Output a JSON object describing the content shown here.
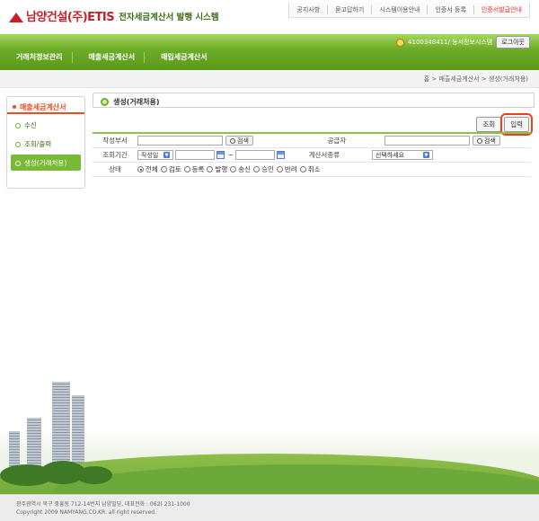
{
  "header": {
    "logo_name": "남양건설(주)ETIS",
    "logo_subtitle": "전자세금계산서 발행 시스템",
    "top_links": [
      "공지사항",
      "묻고답하기",
      "시스템이용안내",
      "인증서 등록",
      "인증서발급안내"
    ]
  },
  "user": {
    "info": "4100348411/ 동서정보시스템",
    "logout_label": "로그아웃"
  },
  "nav": {
    "items": [
      "거래처정보관리",
      "매출세금계산서",
      "매입세금계산서"
    ]
  },
  "breadcrumb": "홈 > 매출세금계산서 > 생성(거래처용)",
  "sidebar": {
    "title": "매출세금계산서",
    "items": [
      "수신",
      "조회/출력",
      "생성(거래처용)"
    ]
  },
  "main": {
    "title": "생성(거래처용)",
    "buttons": {
      "search": "조회",
      "input": "입력"
    }
  },
  "form": {
    "writer_dept_label": "작성부서",
    "supplier_label": "공급자",
    "search_button": "검색",
    "period_label": "조회기간",
    "period_type_value": "작성일",
    "tilde": "~",
    "invoice_type_label": "계산서종류",
    "invoice_type_value": "선택하세요",
    "status_label": "상태",
    "status_options": [
      "전체",
      "검토",
      "등록",
      "발행",
      "송신",
      "승인",
      "반려",
      "취소"
    ]
  },
  "footer": {
    "address": "광주광역시 북구 중흥동 712-14번지 남양빌딩, 대표전화 : 062) 231-1000",
    "copyright": "Copyright 2009 NAMYANG.CO.KR. all right reserved."
  },
  "colors": {
    "brand_green": "#6ead28",
    "brand_red": "#c6202c",
    "accent_orange": "#e94f1d",
    "highlight_box": "#e8411b"
  }
}
